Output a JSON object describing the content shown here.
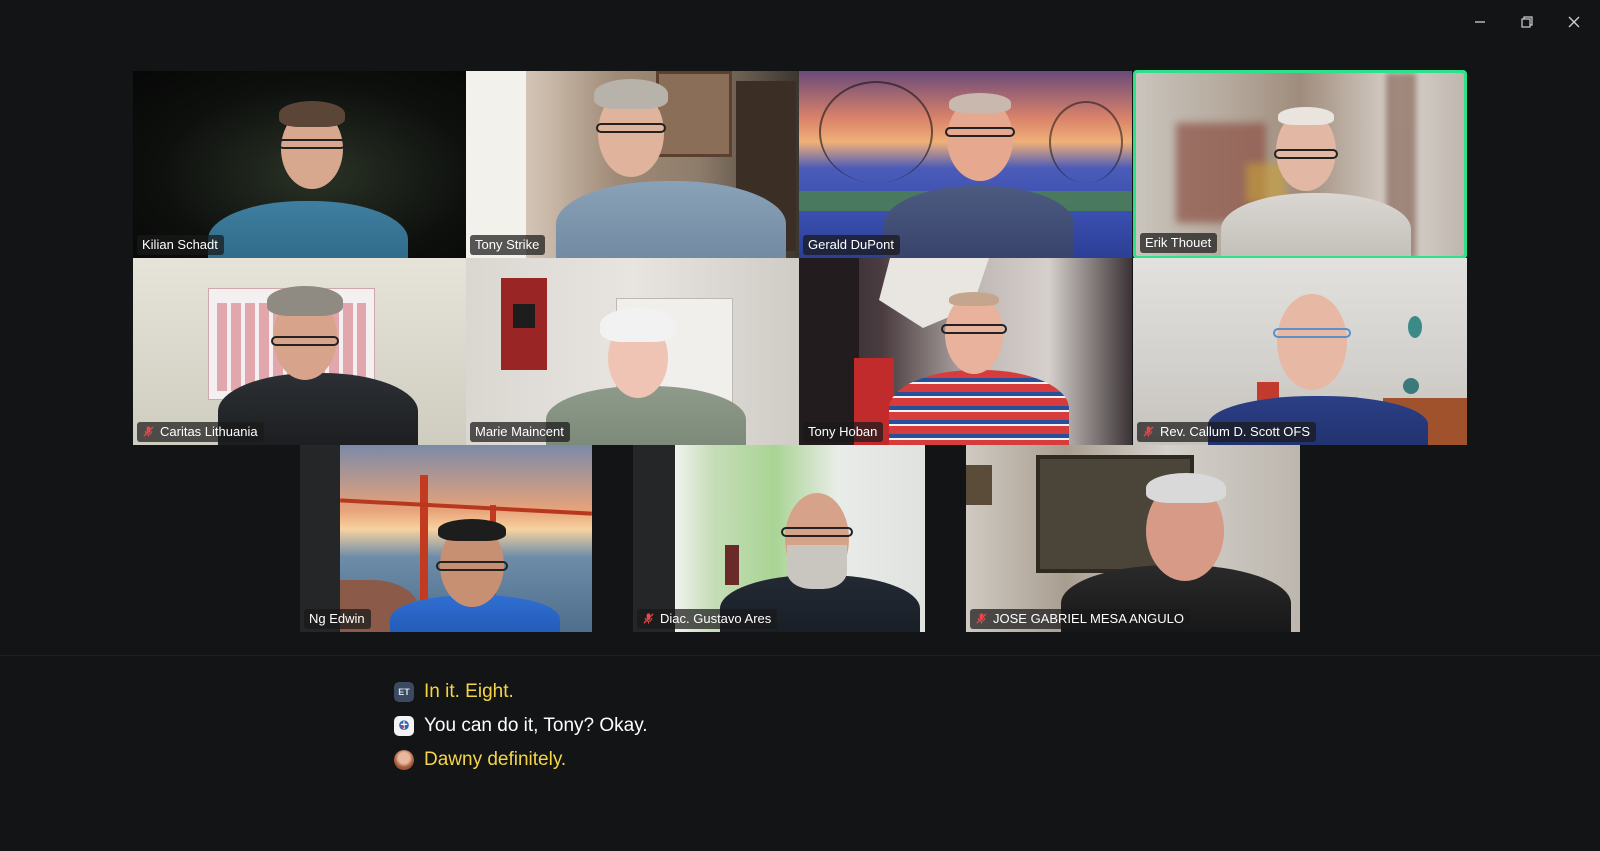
{
  "window": {
    "controls": [
      "minimize",
      "restore",
      "close"
    ]
  },
  "participants": [
    {
      "name": "Kilian Schadt",
      "muted": false,
      "active": false
    },
    {
      "name": "Tony Strike",
      "muted": false,
      "active": false
    },
    {
      "name": "Gerald DuPont",
      "muted": false,
      "active": false
    },
    {
      "name": "Erik  Thouet",
      "muted": false,
      "active": true
    },
    {
      "name": "Caritas Lithuania",
      "muted": true,
      "active": false
    },
    {
      "name": "Marie Maincent",
      "muted": false,
      "active": false
    },
    {
      "name": "Tony Hoban",
      "muted": false,
      "active": false
    },
    {
      "name": "Rev. Callum D. Scott OFS",
      "muted": true,
      "active": false
    },
    {
      "name": "Ng Edwin",
      "muted": false,
      "active": false
    },
    {
      "name": "Diac. Gustavo Ares",
      "muted": true,
      "active": false
    },
    {
      "name": "JOSE GABRIEL MESA ANGULO",
      "muted": true,
      "active": false
    }
  ],
  "captions": [
    {
      "avatar_text": "ET",
      "text": "In it. Eight.",
      "color": "#f5d547"
    },
    {
      "avatar_text": "",
      "text": "You can do it, Tony? Okay.",
      "color": "#ffffff"
    },
    {
      "avatar_text": "",
      "text": "Dawny definitely.",
      "color": "#f5d547"
    }
  ],
  "colors": {
    "active_speaker_border": "#2ee18a",
    "muted_icon": "#e8474a",
    "background": "#121416"
  }
}
